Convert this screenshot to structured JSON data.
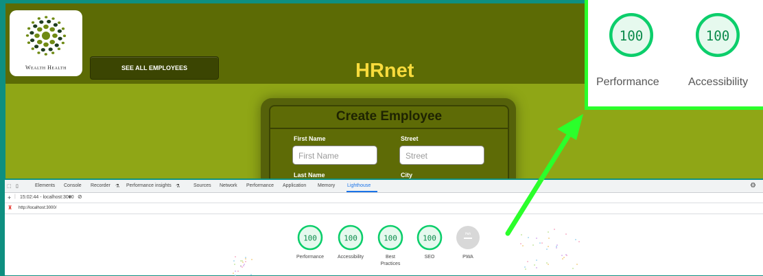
{
  "app": {
    "logo_text": "Wealth Health",
    "see_all_label": "SEE ALL EMPLOYEES",
    "brand": "HRnet",
    "form": {
      "title": "Create Employee",
      "first_name_label": "First Name",
      "first_name_placeholder": "First Name",
      "street_label": "Street",
      "street_placeholder": "Street",
      "last_name_label": "Last Name",
      "city_label": "City"
    }
  },
  "zoom_callout": {
    "scores": [
      {
        "label": "Performance",
        "value": "100"
      },
      {
        "label": "Accessibility",
        "value": "100"
      }
    ],
    "highlight_color": "#2bff2b"
  },
  "devtools": {
    "tabs": [
      "Elements",
      "Console",
      "Recorder",
      "Performance insights",
      "Sources",
      "Network",
      "Performance",
      "Application",
      "Memory",
      "Lighthouse"
    ],
    "active_tab": "Lighthouse",
    "report_selector": "15:02:44 - localhost:3000",
    "url": "http://localhost:3000/",
    "scores": [
      {
        "label": "Performance",
        "value": "100"
      },
      {
        "label": "Accessibility",
        "value": "100"
      },
      {
        "label": "Best Practices",
        "value": "100"
      },
      {
        "label": "SEO",
        "value": "100"
      },
      {
        "label": "PWA",
        "value": "PWA"
      }
    ],
    "pass_color": "#0cce6b"
  }
}
